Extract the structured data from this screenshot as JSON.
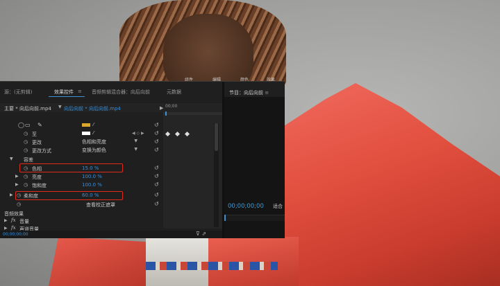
{
  "top_tabs": [
    "组件",
    "编辑",
    "颜色",
    "效果"
  ],
  "panel_tabs": {
    "source": "源：(无剪辑)",
    "effect_controls": "效果控件",
    "menu": "≡",
    "audio_mixer": "音频剪辑混合器：向后向前",
    "metadata": "元数据",
    "program": "节目：向后向前"
  },
  "header": {
    "master": "主要 * 向后向前.mp4",
    "clip": "向后向前 * 向后向前.mp4",
    "timeline_time": "00;00"
  },
  "effect_rows": [
    {
      "name": "至",
      "value": "",
      "kind": "color",
      "color": "#ffffff"
    },
    {
      "name": "更改",
      "value": "色相和亮度",
      "kind": "select"
    },
    {
      "name": "更改方式",
      "value": "变换为颜色",
      "kind": "select"
    },
    {
      "name": "容差",
      "value": "",
      "kind": "group"
    },
    {
      "name": "色相",
      "value": "15.0 %",
      "kind": "value"
    },
    {
      "name": "亮度",
      "value": "100.0 %",
      "kind": "value"
    },
    {
      "name": "饱和度",
      "value": "100.0 %",
      "kind": "value"
    },
    {
      "name": "柔和度",
      "value": "60.0 %",
      "kind": "value"
    }
  ],
  "from_color": "#d9a62e",
  "wrench_label": "查看校正遮罩",
  "audio_section": "音频效果",
  "audio_items": [
    {
      "fx": "fx",
      "name": "音量"
    },
    {
      "fx": "fx",
      "name": "声道音量"
    }
  ],
  "bottom_time": "00;00;00;00",
  "program_time": "00;00;00;00",
  "program_fit": "适合",
  "highlight_color": "#e02a1a"
}
